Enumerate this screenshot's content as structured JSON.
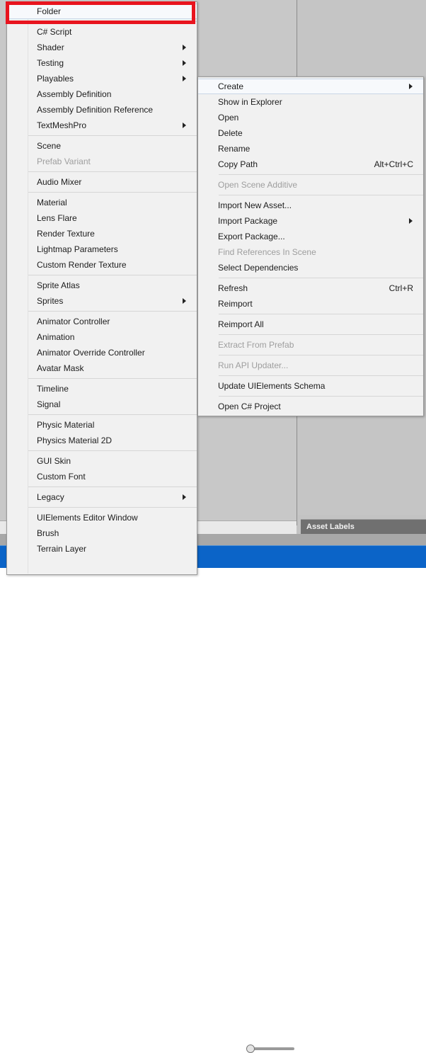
{
  "background": {
    "asset_labels": "Asset Labels"
  },
  "create_menu": {
    "name": "Create submenu",
    "groups": [
      {
        "items": [
          {
            "label": "Folder",
            "highlighted": true,
            "submenu": false,
            "disabled": false,
            "shortcut": ""
          }
        ]
      },
      {
        "items": [
          {
            "label": "C# Script",
            "submenu": false,
            "disabled": false,
            "shortcut": ""
          },
          {
            "label": "Shader",
            "submenu": true,
            "disabled": false,
            "shortcut": ""
          },
          {
            "label": "Testing",
            "submenu": true,
            "disabled": false,
            "shortcut": ""
          },
          {
            "label": "Playables",
            "submenu": true,
            "disabled": false,
            "shortcut": ""
          },
          {
            "label": "Assembly Definition",
            "submenu": false,
            "disabled": false,
            "shortcut": ""
          },
          {
            "label": "Assembly Definition Reference",
            "submenu": false,
            "disabled": false,
            "shortcut": ""
          },
          {
            "label": "TextMeshPro",
            "submenu": true,
            "disabled": false,
            "shortcut": ""
          }
        ]
      },
      {
        "items": [
          {
            "label": "Scene",
            "submenu": false,
            "disabled": false,
            "shortcut": ""
          },
          {
            "label": "Prefab Variant",
            "submenu": false,
            "disabled": true,
            "shortcut": ""
          }
        ]
      },
      {
        "items": [
          {
            "label": "Audio Mixer",
            "submenu": false,
            "disabled": false,
            "shortcut": ""
          }
        ]
      },
      {
        "items": [
          {
            "label": "Material",
            "submenu": false,
            "disabled": false,
            "shortcut": ""
          },
          {
            "label": "Lens Flare",
            "submenu": false,
            "disabled": false,
            "shortcut": ""
          },
          {
            "label": "Render Texture",
            "submenu": false,
            "disabled": false,
            "shortcut": ""
          },
          {
            "label": "Lightmap Parameters",
            "submenu": false,
            "disabled": false,
            "shortcut": ""
          },
          {
            "label": "Custom Render Texture",
            "submenu": false,
            "disabled": false,
            "shortcut": ""
          }
        ]
      },
      {
        "items": [
          {
            "label": "Sprite Atlas",
            "submenu": false,
            "disabled": false,
            "shortcut": ""
          },
          {
            "label": "Sprites",
            "submenu": true,
            "disabled": false,
            "shortcut": ""
          }
        ]
      },
      {
        "items": [
          {
            "label": "Animator Controller",
            "submenu": false,
            "disabled": false,
            "shortcut": ""
          },
          {
            "label": "Animation",
            "submenu": false,
            "disabled": false,
            "shortcut": ""
          },
          {
            "label": "Animator Override Controller",
            "submenu": false,
            "disabled": false,
            "shortcut": ""
          },
          {
            "label": "Avatar Mask",
            "submenu": false,
            "disabled": false,
            "shortcut": ""
          }
        ]
      },
      {
        "items": [
          {
            "label": "Timeline",
            "submenu": false,
            "disabled": false,
            "shortcut": ""
          },
          {
            "label": "Signal",
            "submenu": false,
            "disabled": false,
            "shortcut": ""
          }
        ]
      },
      {
        "items": [
          {
            "label": "Physic Material",
            "submenu": false,
            "disabled": false,
            "shortcut": ""
          },
          {
            "label": "Physics Material 2D",
            "submenu": false,
            "disabled": false,
            "shortcut": ""
          }
        ]
      },
      {
        "items": [
          {
            "label": "GUI Skin",
            "submenu": false,
            "disabled": false,
            "shortcut": ""
          },
          {
            "label": "Custom Font",
            "submenu": false,
            "disabled": false,
            "shortcut": ""
          }
        ]
      },
      {
        "items": [
          {
            "label": "Legacy",
            "submenu": true,
            "disabled": false,
            "shortcut": ""
          }
        ]
      },
      {
        "items": [
          {
            "label": "UIElements Editor Window",
            "submenu": false,
            "disabled": false,
            "shortcut": ""
          },
          {
            "label": "Brush",
            "submenu": false,
            "disabled": false,
            "shortcut": ""
          },
          {
            "label": "Terrain Layer",
            "submenu": false,
            "disabled": false,
            "shortcut": ""
          }
        ]
      }
    ]
  },
  "project_menu": {
    "name": "Project context menu",
    "groups": [
      {
        "items": [
          {
            "label": "Create",
            "highlighted": true,
            "submenu": true,
            "disabled": false,
            "shortcut": ""
          },
          {
            "label": "Show in Explorer",
            "submenu": false,
            "disabled": false,
            "shortcut": ""
          },
          {
            "label": "Open",
            "submenu": false,
            "disabled": false,
            "shortcut": ""
          },
          {
            "label": "Delete",
            "submenu": false,
            "disabled": false,
            "shortcut": ""
          },
          {
            "label": "Rename",
            "submenu": false,
            "disabled": false,
            "shortcut": ""
          },
          {
            "label": "Copy Path",
            "submenu": false,
            "disabled": false,
            "shortcut": "Alt+Ctrl+C"
          }
        ]
      },
      {
        "items": [
          {
            "label": "Open Scene Additive",
            "submenu": false,
            "disabled": true,
            "shortcut": ""
          }
        ]
      },
      {
        "items": [
          {
            "label": "Import New Asset...",
            "submenu": false,
            "disabled": false,
            "shortcut": ""
          },
          {
            "label": "Import Package",
            "submenu": true,
            "disabled": false,
            "shortcut": ""
          },
          {
            "label": "Export Package...",
            "submenu": false,
            "disabled": false,
            "shortcut": ""
          },
          {
            "label": "Find References In Scene",
            "submenu": false,
            "disabled": true,
            "shortcut": ""
          },
          {
            "label": "Select Dependencies",
            "submenu": false,
            "disabled": false,
            "shortcut": ""
          }
        ]
      },
      {
        "items": [
          {
            "label": "Refresh",
            "submenu": false,
            "disabled": false,
            "shortcut": "Ctrl+R"
          },
          {
            "label": "Reimport",
            "submenu": false,
            "disabled": false,
            "shortcut": ""
          }
        ]
      },
      {
        "items": [
          {
            "label": "Reimport All",
            "submenu": false,
            "disabled": false,
            "shortcut": ""
          }
        ]
      },
      {
        "items": [
          {
            "label": "Extract From Prefab",
            "submenu": false,
            "disabled": true,
            "shortcut": ""
          }
        ]
      },
      {
        "items": [
          {
            "label": "Run API Updater...",
            "submenu": false,
            "disabled": true,
            "shortcut": ""
          }
        ]
      },
      {
        "items": [
          {
            "label": "Update UIElements Schema",
            "submenu": false,
            "disabled": false,
            "shortcut": ""
          }
        ]
      },
      {
        "items": [
          {
            "label": "Open C# Project",
            "submenu": false,
            "disabled": false,
            "shortcut": ""
          }
        ]
      }
    ]
  },
  "annotation": {
    "highlight_color": "#e8141e",
    "target_label": "Folder"
  }
}
